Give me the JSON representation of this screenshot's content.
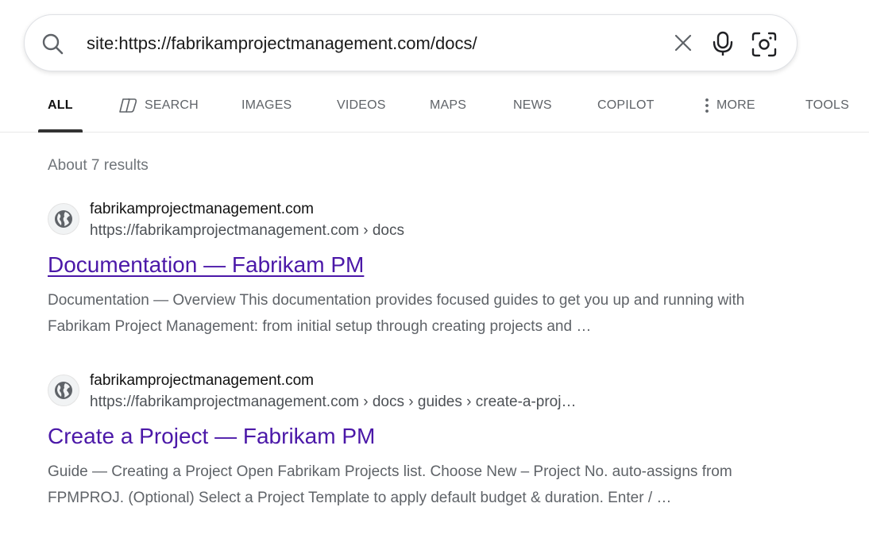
{
  "search": {
    "query": "site:https://fabrikamprojectmanagement.com/docs/",
    "icons": {
      "search": "search-icon",
      "clear": "close-icon",
      "mic": "microphone-icon",
      "visual": "visual-search-icon"
    }
  },
  "nav": {
    "tabs": [
      {
        "label": "ALL",
        "active": true
      },
      {
        "label": "SEARCH",
        "icon": "copilot-search-icon"
      },
      {
        "label": "IMAGES"
      },
      {
        "label": "VIDEOS"
      },
      {
        "label": "MAPS"
      },
      {
        "label": "NEWS"
      },
      {
        "label": "COPILOT"
      },
      {
        "label": "MORE",
        "icon": "vertical-dots-icon"
      },
      {
        "label": "TOOLS"
      }
    ]
  },
  "results_count": "About 7 results",
  "results": [
    {
      "site_name": "fabrikamprojectmanagement.com",
      "url": "https://fabrikamprojectmanagement.com › docs",
      "title": "Documentation — Fabrikam PM",
      "snippet": "Documentation — Overview This documentation provides focused guides to get you up and running with Fabrikam Project Management: from initial setup through creating projects and …",
      "favicon": "globe-icon"
    },
    {
      "site_name": "fabrikamprojectmanagement.com",
      "url": "https://fabrikamprojectmanagement.com › docs › guides › create-a-proj…",
      "title": "Create a Project — Fabrikam PM",
      "snippet": "Guide — Creating a Project Open Fabrikam Projects list. Choose New – Project No. auto-assigns from FPMPROJ. (Optional) Select a Project Template to apply default budget & duration. Enter / …",
      "favicon": "globe-icon"
    }
  ],
  "colors": {
    "link": "#4b18a8",
    "snippet": "#5f6368",
    "muted": "#70757a"
  }
}
